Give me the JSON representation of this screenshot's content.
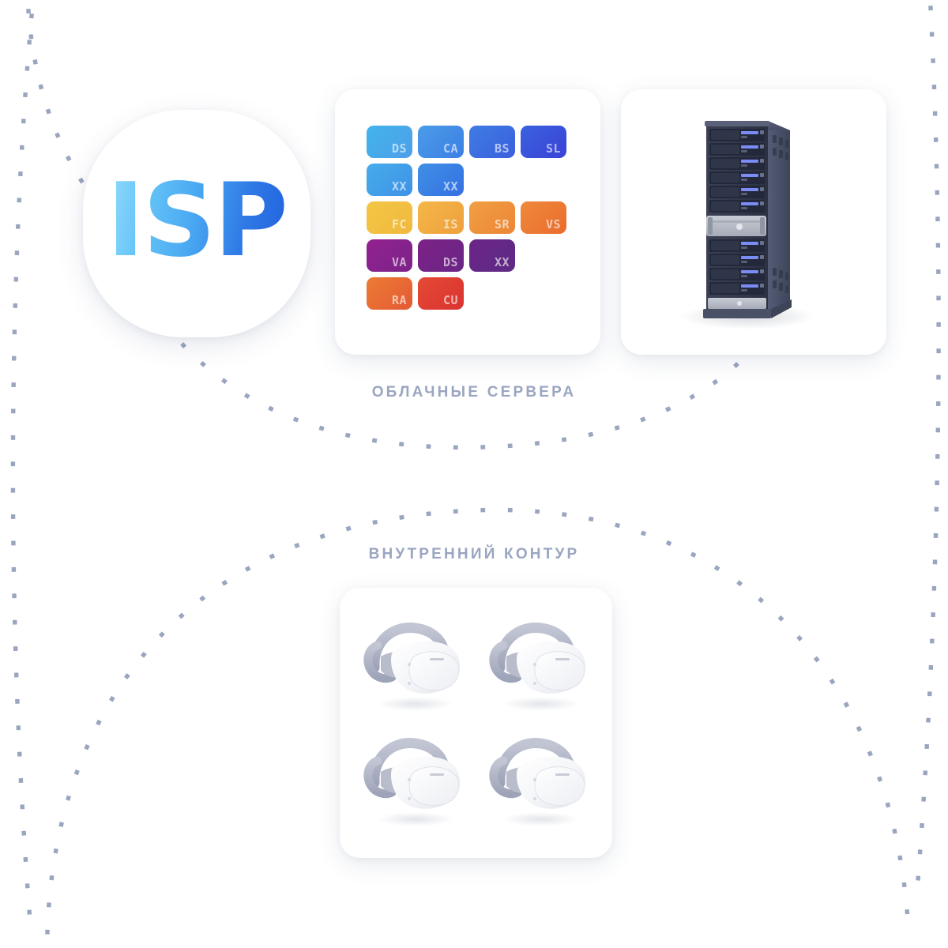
{
  "diagram": {
    "title": "ISP cloud infrastructure diagram",
    "background_color": "#ffffff",
    "accent_color": "#2f7ae6",
    "dot_color": "#9aa5bf"
  },
  "logo": {
    "text": "ISP",
    "gradient_from": "#93dcfb",
    "gradient_to": "#2060dd",
    "shape": "squircle"
  },
  "captions": {
    "cloud": "ОБЛАЧНЫЕ СЕРВЕРА",
    "inner": "ВНУТРЕННИЙ КОНТУР",
    "color": "#9aa5c0"
  },
  "tiles_card": {
    "name": "cloud-services-tiles",
    "rows": [
      [
        {
          "label": "DS",
          "from": "#42b4ec",
          "to": "#4e9fe8"
        },
        {
          "label": "CA",
          "from": "#4b9ce9",
          "to": "#3c7fe4"
        },
        {
          "label": "BS",
          "from": "#3f7ce4",
          "to": "#3b5fdd"
        },
        {
          "label": "SL",
          "from": "#3a62de",
          "to": "#3a42d6"
        }
      ],
      [
        {
          "label": "XX",
          "from": "#46acea",
          "to": "#3f92e6"
        },
        {
          "label": "XX",
          "from": "#3f90e6",
          "to": "#3570e2"
        }
      ],
      [
        {
          "label": "FC",
          "from": "#f4c645",
          "to": "#f0b93f"
        },
        {
          "label": "IS",
          "from": "#f3b848",
          "to": "#ef9f3d"
        },
        {
          "label": "SR",
          "from": "#f0a043",
          "to": "#ec8536"
        },
        {
          "label": "VS",
          "from": "#ef8a3c",
          "to": "#e96c2c"
        }
      ],
      [
        {
          "label": "VA",
          "from": "#93218f",
          "to": "#7b2389"
        },
        {
          "label": "DS",
          "from": "#7c2287",
          "to": "#6a2585"
        },
        {
          "label": "XX",
          "from": "#6c2586",
          "to": "#5d2a85"
        }
      ],
      [
        {
          "label": "RA",
          "from": "#ec7c35",
          "to": "#e35a33"
        },
        {
          "label": "CU",
          "from": "#e44a34",
          "to": "#da3331"
        }
      ]
    ]
  },
  "rack_card": {
    "name": "server-rack",
    "description": "dark slate server rack with drive bays",
    "body_color": "#4a5068",
    "front_color": "#2e3342",
    "led_color": "#7b8cf5",
    "panel_color": "#b8bcc6",
    "bay_count": 8
  },
  "vr_card": {
    "name": "vr-headsets",
    "count": 4,
    "device_color": "#ffffff",
    "strap_color": "#a9aec0"
  },
  "arcs": {
    "dot_shape": "square",
    "dot_size_px": 5,
    "paths": [
      {
        "name": "arc-isp-to-cloud",
        "dots": 24
      },
      {
        "name": "arc-inner-contour",
        "dots": 40
      },
      {
        "name": "arc-outer-perimeter",
        "dots": 60
      }
    ]
  }
}
